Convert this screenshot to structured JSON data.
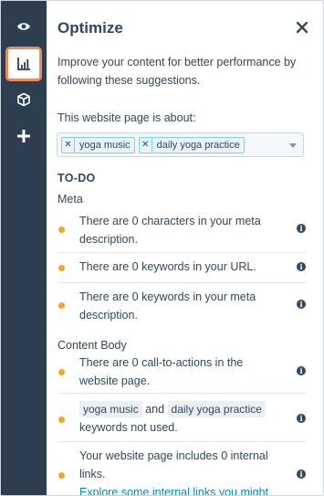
{
  "rail": {
    "items": [
      {
        "icon": "eye-icon"
      },
      {
        "icon": "chart-icon",
        "active": true
      },
      {
        "icon": "cube-icon"
      },
      {
        "icon": "plus-icon"
      }
    ]
  },
  "panel": {
    "title": "Optimize",
    "close_icon": "close-icon",
    "intro": "Improve your content for better performance by following these suggestions.",
    "about_label": "This website page is about:",
    "topics": [
      "yoga music",
      "daily yoga practice"
    ],
    "todo_heading": "TO-DO",
    "meta_section": "Meta",
    "meta_items": [
      "There are 0 characters in your meta description.",
      "There are 0 keywords in your URL.",
      "There are 0 keywords in your meta description."
    ],
    "content_section": "Content Body",
    "content_item_1": "There are 0 call-to-actions in the website page.",
    "content_item_2": {
      "kw1": "yoga music",
      "and": "and",
      "kw2": "daily yoga practice",
      "rest": "keywords not used."
    },
    "content_item_3": {
      "text": "Your website page includes 0 internal links.",
      "link": "Explore some internal links you might use in this website page."
    }
  },
  "colors": {
    "rail_bg": "#2d3e50",
    "active_highlight": "#ef8a5b",
    "status_dot": "#f5a623",
    "link": "#0091ae"
  }
}
